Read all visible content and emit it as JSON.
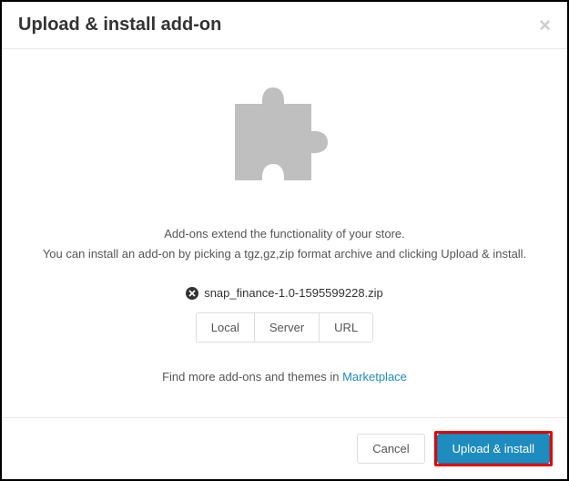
{
  "header": {
    "title": "Upload & install add-on"
  },
  "body": {
    "desc_line1": "Add-ons extend the functionality of your store.",
    "desc_line2": "You can install an add-on by picking a tgz,gz,zip format archive and clicking Upload & install.",
    "selected_file": "snap_finance-1.0-1595599228.zip",
    "source_buttons": {
      "local": "Local",
      "server": "Server",
      "url": "URL"
    },
    "marketplace_prefix": "Find more add-ons and themes in ",
    "marketplace_link": "Marketplace"
  },
  "footer": {
    "cancel": "Cancel",
    "submit": "Upload & install"
  }
}
